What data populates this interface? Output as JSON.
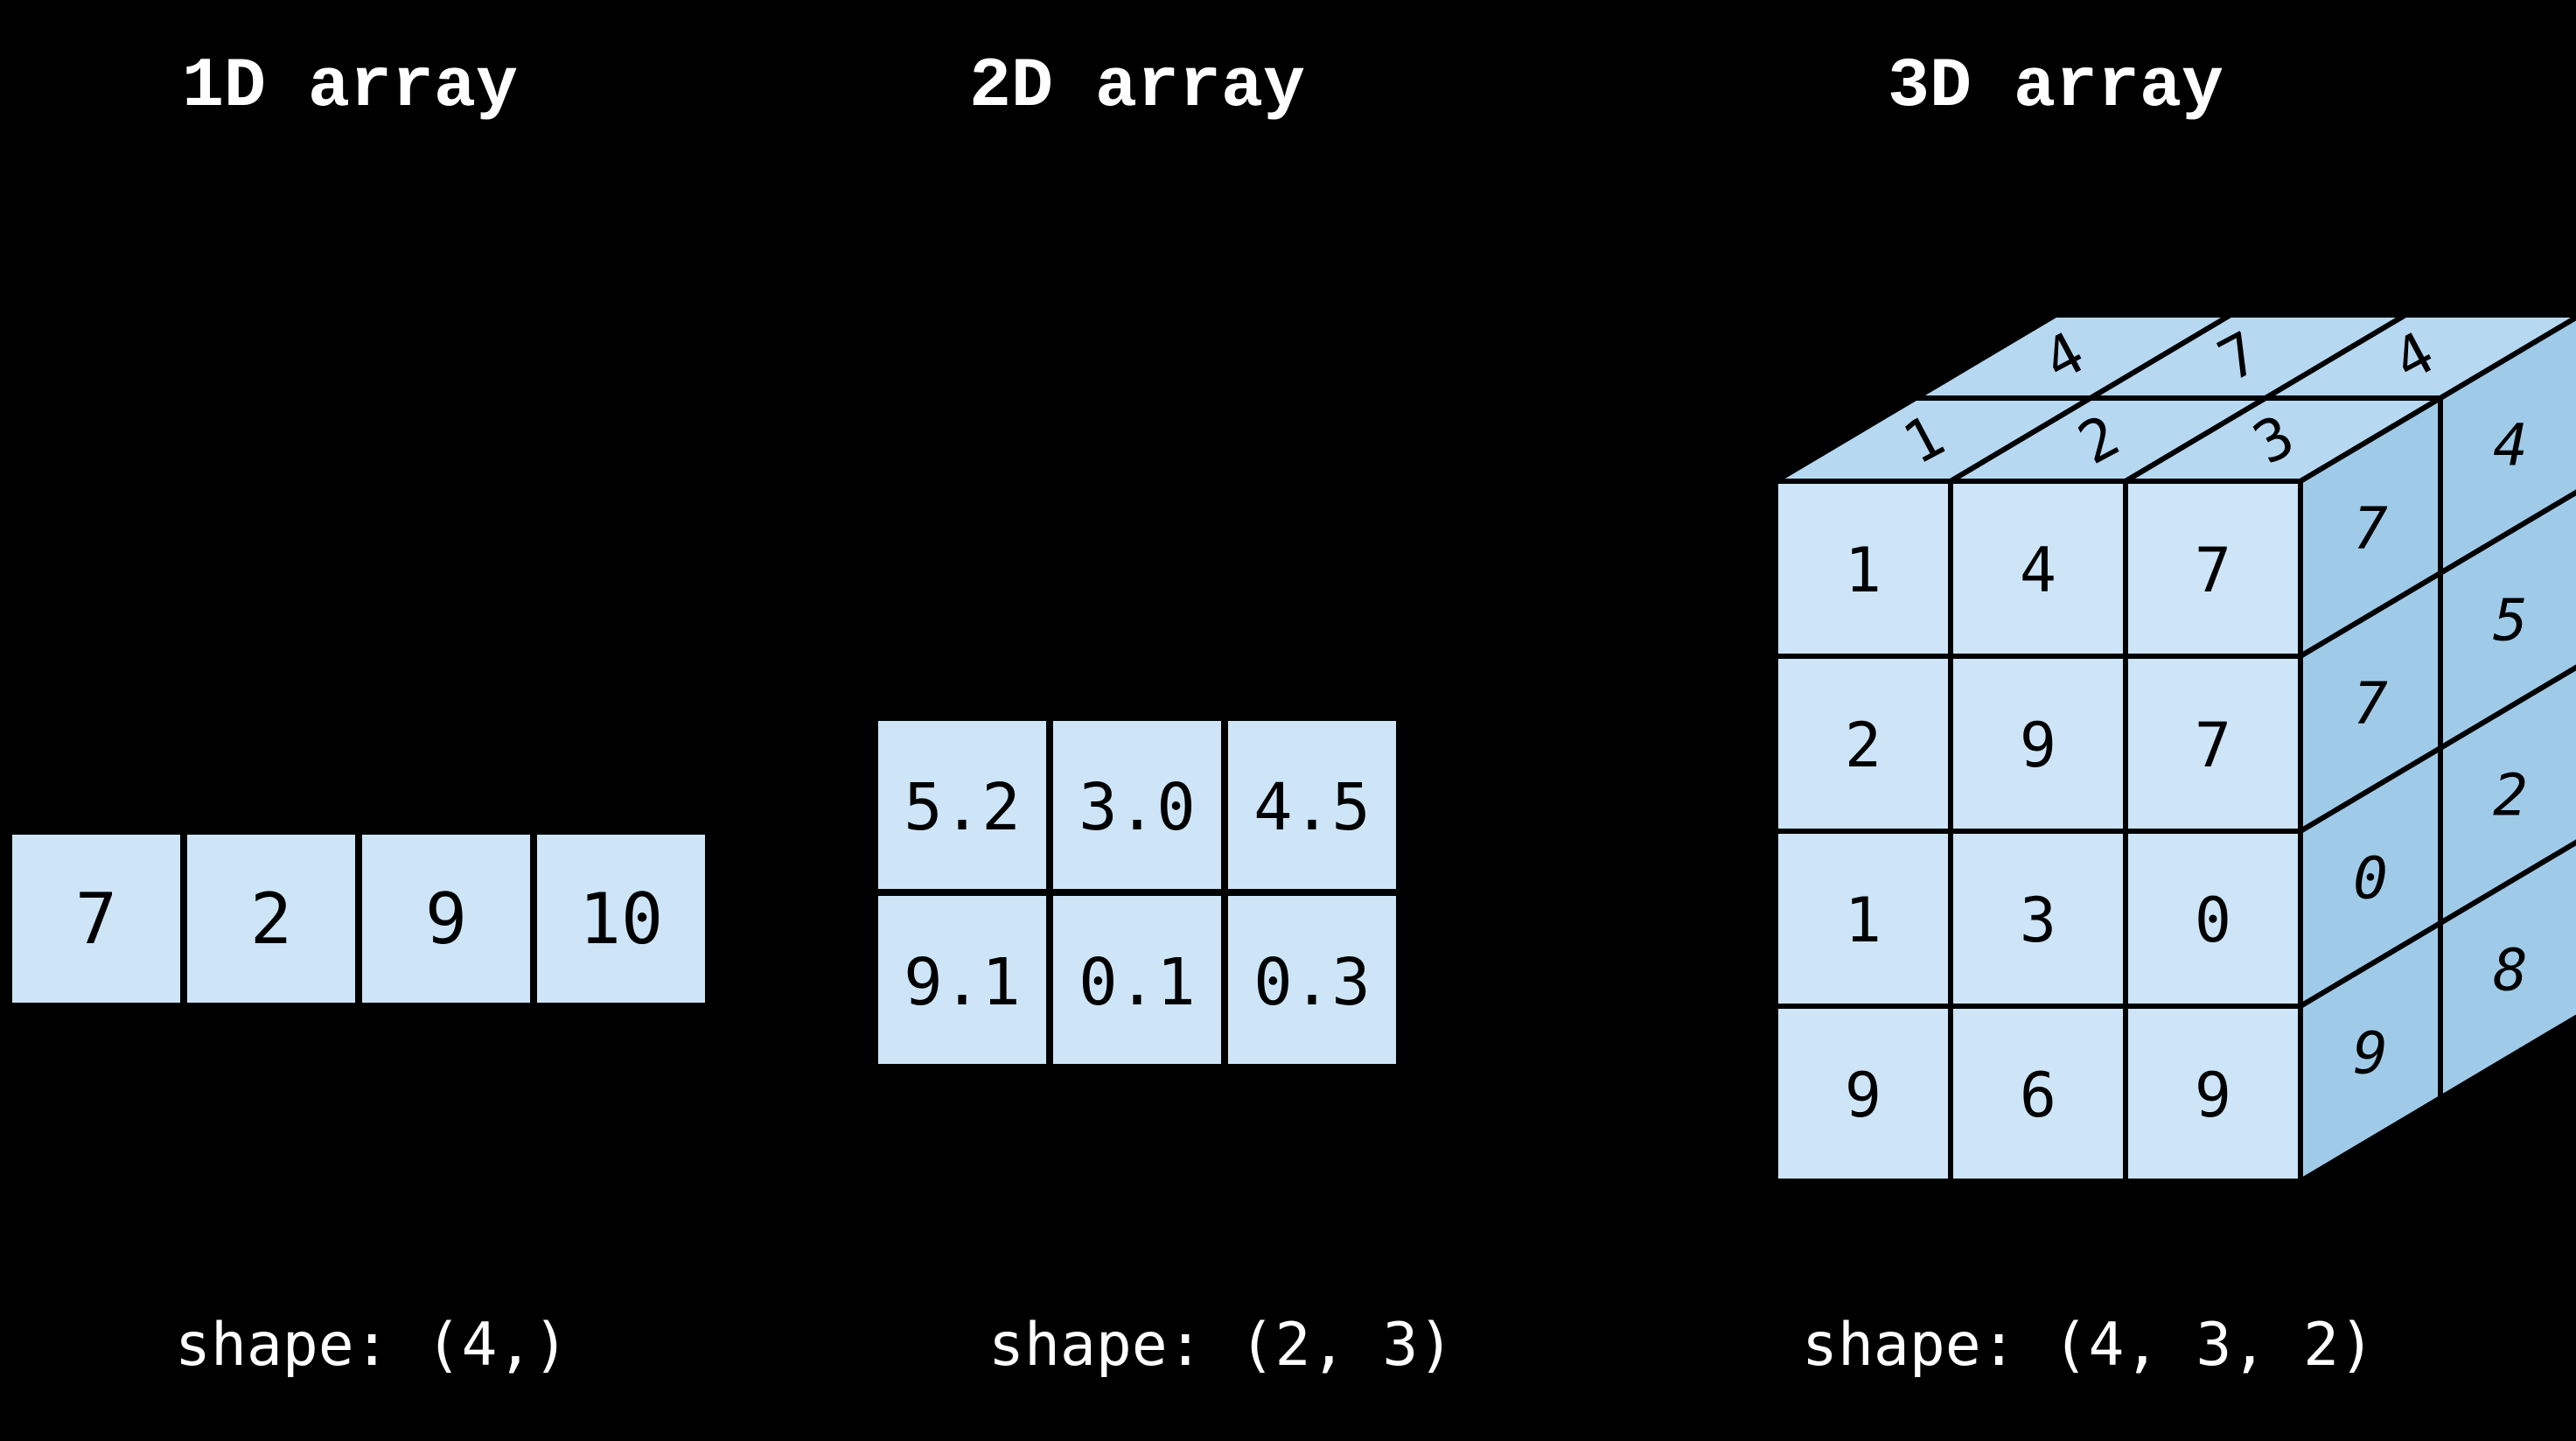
{
  "panels": [
    {
      "title": "1D array",
      "shape_label": "shape: (4,)"
    },
    {
      "title": "2D array",
      "shape_label": "shape: (2, 3)"
    },
    {
      "title": "3D array",
      "shape_label": "shape: (4, 3, 2)"
    }
  ],
  "oneD": {
    "values": [
      "7",
      "2",
      "9",
      "10"
    ]
  },
  "twoD": {
    "rows": [
      [
        "5.2",
        "3.0",
        "4.5"
      ],
      [
        "9.1",
        "0.1",
        "0.3"
      ]
    ]
  },
  "threeD": {
    "top_rows": [
      [
        "1",
        "2",
        "3"
      ],
      [
        "4",
        "7",
        "4"
      ]
    ],
    "side_rows": [
      [
        "7",
        "4"
      ],
      [
        "7",
        "5"
      ],
      [
        "0",
        "2"
      ],
      [
        "9",
        "8"
      ]
    ],
    "front_rows": [
      [
        "1",
        "4",
        "7"
      ],
      [
        "2",
        "9",
        "7"
      ],
      [
        "1",
        "3",
        "0"
      ],
      [
        "9",
        "6",
        "9"
      ]
    ]
  },
  "colors": {
    "cell_light": "#cde5f7",
    "cell_mid": "#b7d8f1",
    "cell_dark": "#9fcbe9",
    "stroke": "#000000",
    "title": "#ffffff"
  }
}
